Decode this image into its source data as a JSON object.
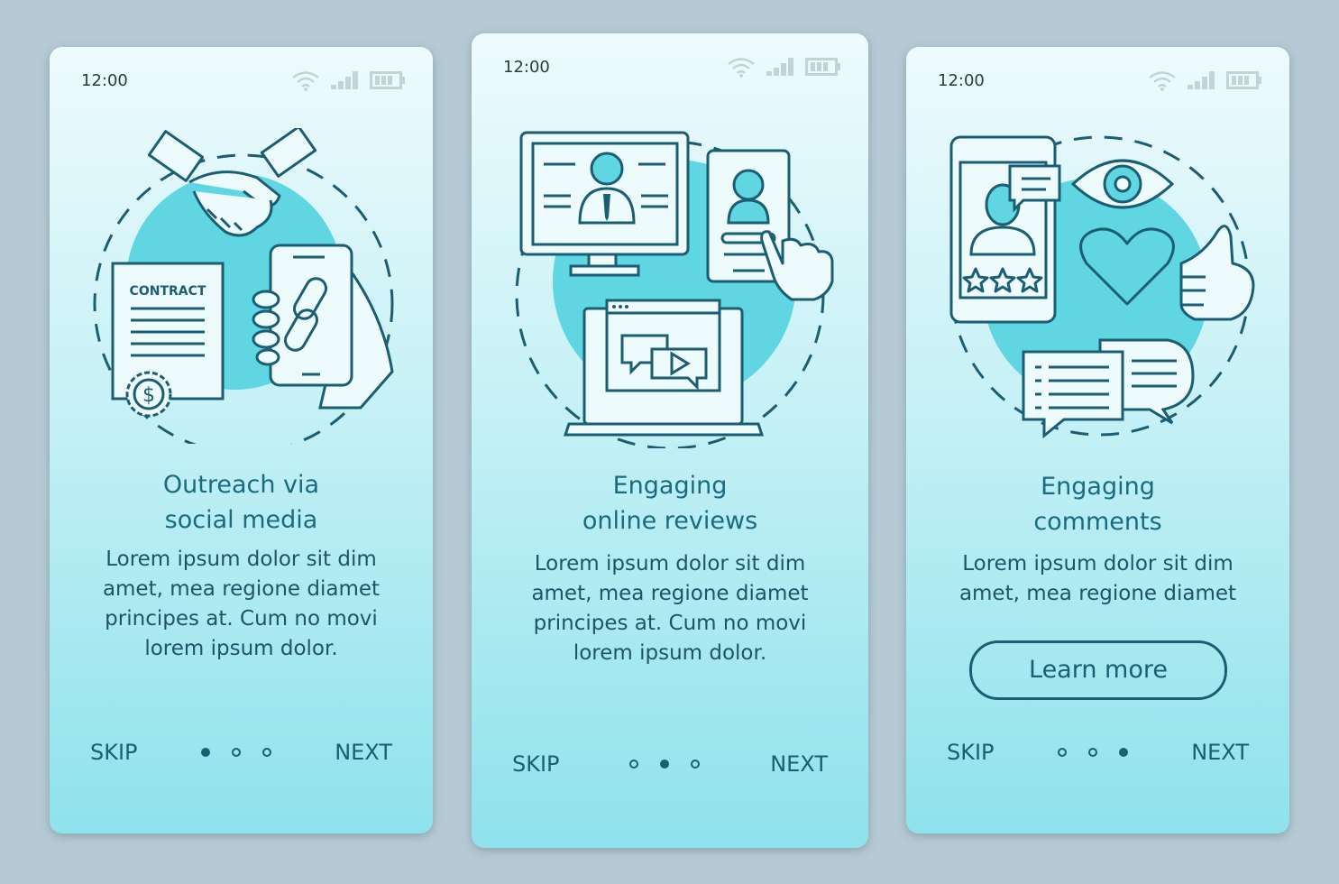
{
  "colors": {
    "background": "#b5cad4",
    "accent": "#1b5e73",
    "blob": "#5fd6e2"
  },
  "screens": [
    {
      "status": {
        "time": "12:00",
        "icons": [
          "wifi-icon",
          "signal-icon",
          "battery-icon"
        ]
      },
      "illustration": [
        "handshake-icon",
        "contract-icon",
        "smartphone-link-icon",
        "dollar-seal-icon"
      ],
      "contract_label": "CONTRACT",
      "title_line1": "Outreach via",
      "title_line2": "social media",
      "body": [
        "Lorem ipsum dolor sit dim",
        "amet, mea regione diamet",
        "principes at. Cum no movi",
        "lorem ipsum dolor."
      ],
      "skip": "SKIP",
      "next": "NEXT",
      "page_index": 1,
      "page_count": 3
    },
    {
      "status": {
        "time": "12:00",
        "icons": [
          "wifi-icon",
          "signal-icon",
          "battery-icon"
        ]
      },
      "illustration": [
        "monitor-profile-icon",
        "smartphone-profile-icon",
        "pointing-hand-icon",
        "laptop-video-chat-icon"
      ],
      "title_line1": "Engaging",
      "title_line2": "online reviews",
      "body": [
        "Lorem ipsum dolor sit dim",
        "amet, mea regione diamet",
        "principes at. Cum no movi",
        "lorem ipsum dolor."
      ],
      "skip": "SKIP",
      "next": "NEXT",
      "page_index": 2,
      "page_count": 3
    },
    {
      "status": {
        "time": "12:00",
        "icons": [
          "wifi-icon",
          "signal-icon",
          "battery-icon"
        ]
      },
      "illustration": [
        "smartphone-rating-icon",
        "eye-icon",
        "heart-icon",
        "thumbs-up-icon",
        "comment-bubbles-icon"
      ],
      "title_line1": "Engaging",
      "title_line2": "comments",
      "body": [
        "Lorem ipsum dolor sit dim",
        "amet, mea regione diamet"
      ],
      "learn_more": "Learn more",
      "skip": "SKIP",
      "next": "NEXT",
      "page_index": 3,
      "page_count": 3
    }
  ]
}
